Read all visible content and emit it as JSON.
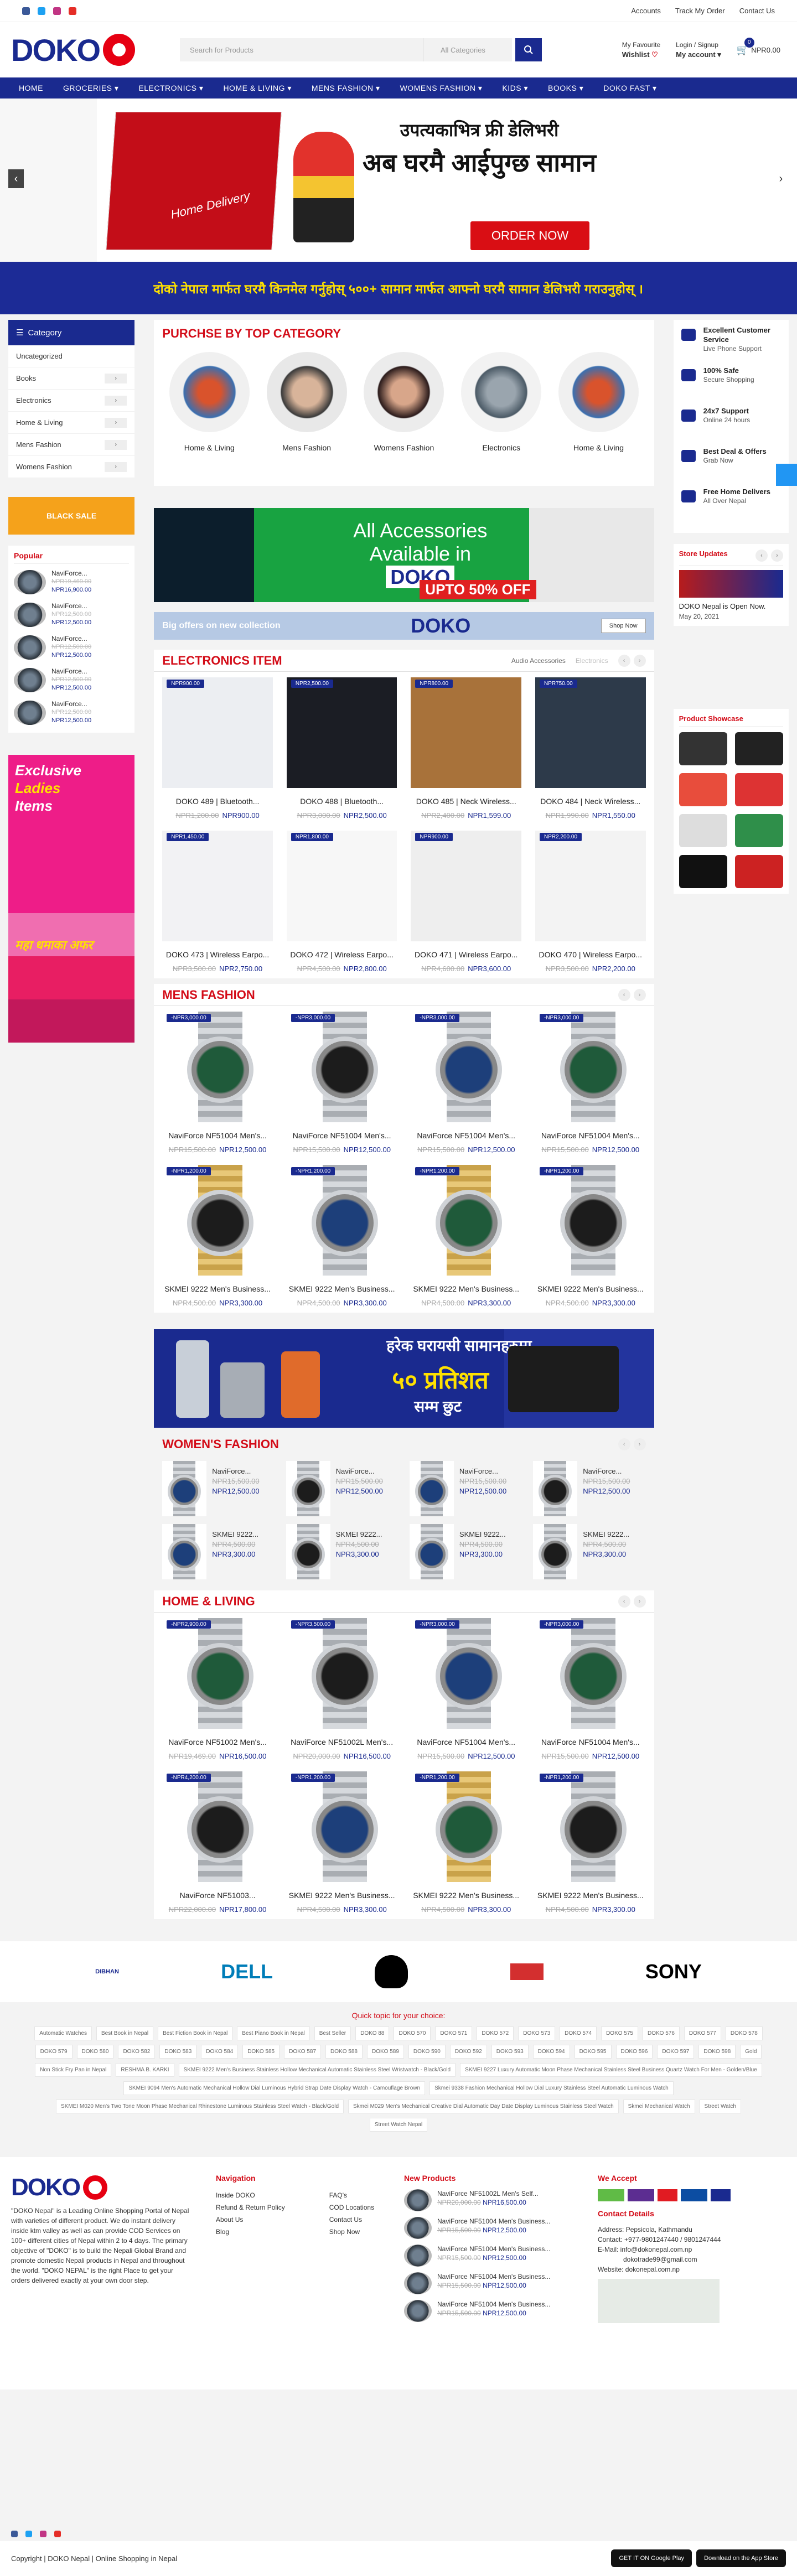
{
  "top_links": [
    "Accounts",
    "Track My Order",
    "Contact Us"
  ],
  "logo": "DOKO",
  "search": {
    "placeholder": "Search for Products",
    "category": "All Categories"
  },
  "header": {
    "wishlist_small": "My Favourite",
    "wishlist": "Wishlist",
    "login_small": "Login / Signup",
    "account": "My account",
    "cart_count": "0",
    "cart_total": "NPR0.00"
  },
  "nav": [
    "HOME",
    "GROCERIES ▾",
    "ELECTRONICS ▾",
    "HOME & LIVING ▾",
    "MENS FASHION ▾",
    "WOMENS FASHION ▾",
    "KIDS ▾",
    "BOOKS ▾",
    "DOKO FAST ▾"
  ],
  "hero": {
    "line1": "उपत्यकाभित्र फ्री डेलिभरी",
    "line2": "अब घरमै आईपुग्छ सामान",
    "badge": "Home Delivery",
    "button": "ORDER NOW",
    "prev": "‹",
    "next": "›"
  },
  "strip": "दोको नेपाल मार्फत घरमै किनमेल गर्नुहोस् ५००+ सामान मार्फत आफ्नो घरमै सामान डेलिभरी गराउनुहोस् ।",
  "sidebar": {
    "title": "Category",
    "items": [
      {
        "label": "Uncategorized",
        "more": ""
      },
      {
        "label": "Books",
        "more": "›"
      },
      {
        "label": "Electronics",
        "more": "›"
      },
      {
        "label": "Home & Living",
        "more": "›"
      },
      {
        "label": "Mens Fashion",
        "more": "›"
      },
      {
        "label": "Womens Fashion",
        "more": "›"
      }
    ],
    "promo": "BLACK SALE"
  },
  "popular": {
    "title": "Popular",
    "items": [
      {
        "name": "NaviForce...",
        "old": "NPR19,469.00",
        "new": "NPR16,900.00"
      },
      {
        "name": "NaviForce...",
        "old": "NPR12,500.00",
        "new": "NPR12,500.00"
      },
      {
        "name": "NaviForce...",
        "old": "NPR12,500.00",
        "new": "NPR12,500.00"
      },
      {
        "name": "NaviForce...",
        "old": "NPR12,500.00",
        "new": "NPR12,500.00"
      },
      {
        "name": "NaviForce...",
        "old": "NPR12,500.00",
        "new": "NPR12,500.00"
      }
    ]
  },
  "ladies": {
    "l1": "Exclusive",
    "l2": "Ladies",
    "l3": "Items",
    "l4": "महा धमाका अफर"
  },
  "top_category": {
    "title": "PURCHSE BY TOP CATEGORY",
    "items": [
      "Home & Living",
      "Mens Fashion",
      "Womens Fashion",
      "Electronics",
      "Home & Living"
    ]
  },
  "acc_banner": {
    "l1": "All Accessories",
    "l2": "Available in",
    "brand": "DOKO",
    "off": "UPTO 50% OFF"
  },
  "offer_banner": {
    "text": "Big offers on new collection",
    "brand": "DOKO",
    "button": "Shop Now"
  },
  "electronics": {
    "title": "ELECTRONICS ITEM",
    "tabs": [
      "Audio Accessories",
      "Electronics"
    ],
    "products": [
      {
        "tag": "NPR900.00",
        "name": "DOKO 489 | Bluetooth...",
        "old": "NPR1,200.00",
        "new": "NPR900.00"
      },
      {
        "tag": "NPR2,500.00",
        "name": "DOKO 488 | Bluetooth...",
        "old": "NPR3,000.00",
        "new": "NPR2,500.00"
      },
      {
        "tag": "NPR800.00",
        "name": "DOKO 485 | Neck Wireless...",
        "old": "NPR2,400.00",
        "new": "NPR1,599.00"
      },
      {
        "tag": "NPR750.00",
        "name": "DOKO 484 | Neck Wireless...",
        "old": "NPR1,990.00",
        "new": "NPR1,550.00"
      },
      {
        "tag": "NPR1,450.00",
        "name": "DOKO 473 | Wireless Earpo...",
        "old": "NPR3,500.00",
        "new": "NPR2,750.00"
      },
      {
        "tag": "NPR1,800.00",
        "name": "DOKO 472 | Wireless Earpo...",
        "old": "NPR4,500.00",
        "new": "NPR2,800.00"
      },
      {
        "tag": "NPR900.00",
        "name": "DOKO 471 | Wireless Earpo...",
        "old": "NPR4,600.00",
        "new": "NPR3,600.00"
      },
      {
        "tag": "NPR2,200.00",
        "name": "DOKO 470 | Wireless Earpo...",
        "old": "NPR3,500.00",
        "new": "NPR2,200.00"
      }
    ]
  },
  "mens": {
    "title": "MENS FASHION",
    "products": [
      {
        "tag": "-NPR3,000.00",
        "name": "NaviForce NF51004 Men's...",
        "old": "NPR15,500.00",
        "new": "NPR12,500.00"
      },
      {
        "tag": "-NPR3,000.00",
        "name": "NaviForce NF51004 Men's...",
        "old": "NPR15,500.00",
        "new": "NPR12,500.00"
      },
      {
        "tag": "-NPR3,000.00",
        "name": "NaviForce NF51004 Men's...",
        "old": "NPR15,500.00",
        "new": "NPR12,500.00"
      },
      {
        "tag": "-NPR3,000.00",
        "name": "NaviForce NF51004 Men's...",
        "old": "NPR15,500.00",
        "new": "NPR12,500.00"
      },
      {
        "tag": "-NPR1,200.00",
        "name": "SKMEI 9222 Men's Business...",
        "old": "NPR4,500.00",
        "new": "NPR3,300.00"
      },
      {
        "tag": "-NPR1,200.00",
        "name": "SKMEI 9222 Men's Business...",
        "old": "NPR4,500.00",
        "new": "NPR3,300.00"
      },
      {
        "tag": "-NPR1,200.00",
        "name": "SKMEI 9222 Men's Business...",
        "old": "NPR4,500.00",
        "new": "NPR3,300.00"
      },
      {
        "tag": "-NPR1,200.00",
        "name": "SKMEI 9222 Men's Business...",
        "old": "NPR4,500.00",
        "new": "NPR3,300.00"
      }
    ]
  },
  "kitchen": {
    "l1": "हरेक घरायसी सामानहरुमा",
    "l2": "५० प्रतिशत",
    "l3": "सम्म छुट"
  },
  "womens": {
    "title": "WOMEN'S FASHION",
    "products": [
      {
        "name": "NaviForce...",
        "old": "NPR15,500.00",
        "new": "NPR12,500.00"
      },
      {
        "name": "NaviForce...",
        "old": "NPR15,500.00",
        "new": "NPR12,500.00"
      },
      {
        "name": "NaviForce...",
        "old": "NPR15,500.00",
        "new": "NPR12,500.00"
      },
      {
        "name": "NaviForce...",
        "old": "NPR15,500.00",
        "new": "NPR12,500.00"
      },
      {
        "name": "SKMEI 9222...",
        "old": "NPR4,500.00",
        "new": "NPR3,300.00"
      },
      {
        "name": "SKMEI 9222...",
        "old": "NPR4,500.00",
        "new": "NPR3,300.00"
      },
      {
        "name": "SKMEI 9222...",
        "old": "NPR4,500.00",
        "new": "NPR3,300.00"
      },
      {
        "name": "SKMEI 9222...",
        "old": "NPR4,500.00",
        "new": "NPR3,300.00"
      }
    ]
  },
  "home": {
    "title": "HOME & LIVING",
    "products": [
      {
        "tag": "-NPR2,900.00",
        "name": "NaviForce NF51002 Men's...",
        "old": "NPR19,469.00",
        "new": "NPR16,500.00"
      },
      {
        "tag": "-NPR3,500.00",
        "name": "NaviForce NF51002L Men's...",
        "old": "NPR20,000.00",
        "new": "NPR16,500.00"
      },
      {
        "tag": "-NPR3,000.00",
        "name": "NaviForce NF51004 Men's...",
        "old": "NPR15,500.00",
        "new": "NPR12,500.00"
      },
      {
        "tag": "-NPR3,000.00",
        "name": "NaviForce NF51004 Men's...",
        "old": "NPR15,500.00",
        "new": "NPR12,500.00"
      },
      {
        "tag": "-NPR4,200.00",
        "name": "NaviForce NF51003...",
        "old": "NPR22,000.00",
        "new": "NPR17,800.00"
      },
      {
        "tag": "-NPR1,200.00",
        "name": "SKMEI 9222 Men's Business...",
        "old": "NPR4,500.00",
        "new": "NPR3,300.00"
      },
      {
        "tag": "-NPR1,200.00",
        "name": "SKMEI 9222 Men's Business...",
        "old": "NPR4,500.00",
        "new": "NPR3,300.00"
      },
      {
        "tag": "-NPR1,200.00",
        "name": "SKMEI 9222 Men's Business...",
        "old": "NPR4,500.00",
        "new": "NPR3,300.00"
      }
    ]
  },
  "features": [
    {
      "t": "Excellent Customer Service",
      "s": "Live Phone Support"
    },
    {
      "t": "100% Safe",
      "s": "Secure Shopping"
    },
    {
      "t": "24x7 Support",
      "s": "Online 24 hours"
    },
    {
      "t": "Best Deal & Offers",
      "s": "Grab Now"
    },
    {
      "t": "Free Home Delivers",
      "s": "All Over Nepal"
    }
  ],
  "store_updates": {
    "title": "Store Updates",
    "post": "DOKO Nepal is Open Now.",
    "date": "May 20, 2021"
  },
  "showcase": {
    "title": "Product Showcase"
  },
  "brands": [
    "DIBHAN",
    "DELL",
    "",
    "",
    "SONY"
  ],
  "topics": {
    "title": "Quick topic for your choice:",
    "tags": [
      "Automatic Watches",
      "Best Book in Nepal",
      "Best Fiction Book in Nepal",
      "Best Piano Book in Nepal",
      "Best Seller",
      "DOKO 88",
      "DOKO 570",
      "DOKO 571",
      "DOKO 572",
      "DOKO 573",
      "DOKO 574",
      "DOKO 575",
      "DOKO 576",
      "DOKO 577",
      "DOKO 578",
      "DOKO 579",
      "DOKO 580",
      "DOKO 582",
      "DOKO 583",
      "DOKO 584",
      "DOKO 585",
      "DOKO 587",
      "DOKO 588",
      "DOKO 589",
      "DOKO 590",
      "DOKO 592",
      "DOKO 593",
      "DOKO 594",
      "DOKO 595",
      "DOKO 596",
      "DOKO 597",
      "DOKO 598",
      "Gold",
      "Non Stick Fry Pan in Nepal",
      "RESHMA B. KARKI",
      "SKMEI 9222 Men's Business Stainless Hollow Mechanical Automatic Stainless Steel Wristwatch - Black/Gold",
      "SKMEI 9227 Luxury Automatic Moon Phase Mechanical Stainless Steel Business Quartz Watch For Men - Golden/Blue",
      "SKMEI 9094 Men's Automatic Mechanical Hollow Dial Luminous Hybrid Strap Date Display Watch - Camouflage Brown",
      "Skmei 9338 Fashion Mechanical Hollow Dial Luxury Stainless Steel Automatic Luminous Watch",
      "SKMEI M020 Men's Two Tone Moon Phase Mechanical Rhinestone Luminous Stainless Steel Watch - Black/Gold",
      "Skmei M029 Men's Mechanical Creative Dial Automatic Day Date Display Luminous Stainless Steel Watch",
      "Skmei Mechanical Watch",
      "Street Watch",
      "Street Watch Nepal"
    ]
  },
  "footer": {
    "about": "\"DOKO Nepal\" is a Leading Online Shopping Portal of Nepal with varieties of different product. We do instant delivery inside ktm valley as well as can provide COD Services on 100+ different cities of Nepal within 2 to 4 days. The primary objective of \"DOKO\" is to build the Nepali Global Brand and promote domestic Nepali products in Nepal and throughout the world. \"DOKO NEPAL\" is the right Place to get your orders delivered exactly at your own door step.",
    "nav_title": "Navigation",
    "nav1": [
      "Inside DOKO",
      "Refund & Return Policy",
      "About Us",
      "Blog"
    ],
    "nav2": [
      "FAQ's",
      "COD Locations",
      "Contact Us",
      "Shop Now"
    ],
    "new_title": "New Products",
    "new": [
      {
        "name": "NaviForce NF51002L Men's Self...",
        "old": "NPR20,000.00",
        "new": "NPR16,500.00"
      },
      {
        "name": "NaviForce NF51004 Men's Business...",
        "old": "NPR15,500.00",
        "new": "NPR12,500.00"
      },
      {
        "name": "NaviForce NF51004 Men's Business...",
        "old": "NPR15,500.00",
        "new": "NPR12,500.00"
      },
      {
        "name": "NaviForce NF51004 Men's Business...",
        "old": "NPR15,500.00",
        "new": "NPR12,500.00"
      },
      {
        "name": "NaviForce NF51004 Men's Business...",
        "old": "NPR15,500.00",
        "new": "NPR12,500.00"
      }
    ],
    "accept_title": "We Accept",
    "contact_title": "Contact Details",
    "address": "Address: Pepsicola, Kathmandu",
    "contact": "Contact: +977-9801247440 / 9801247444",
    "email": "E-Mail: info@dokonepal.com.np",
    "email2": "dokotrade99@gmail.com",
    "website": "Website: dokonepal.com.np"
  },
  "copyright": "Copyright | DOKO Nepal | Online Shopping in Nepal",
  "store_badges": [
    "GET IT ON Google Play",
    "Download on the App Store"
  ]
}
